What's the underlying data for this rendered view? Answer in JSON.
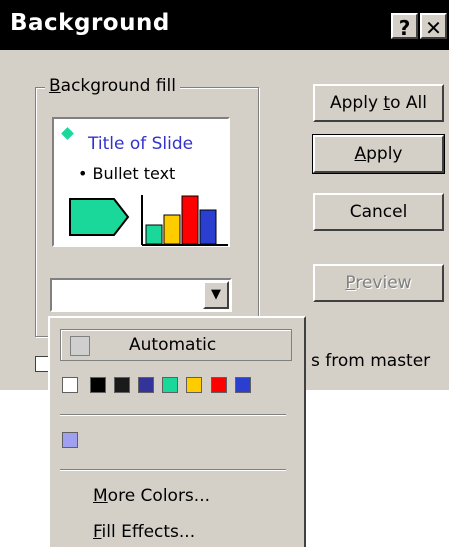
{
  "dialog": {
    "title": "Background",
    "help_label": "?",
    "close_label": "✕",
    "group_label": "Background fill",
    "group_label_access": "B",
    "group_label_rest": "ackground fill",
    "preview": {
      "title_text": "Title of Slide",
      "bullet_text": "• Bullet text"
    },
    "combo_arrow": "▼",
    "buttons": {
      "apply_all_pre": "Apply ",
      "apply_all_key": "t",
      "apply_all_post": "o All",
      "apply_key": "A",
      "apply_rest": "pply",
      "cancel": "Cancel",
      "preview_key": "P",
      "preview_rest": "review"
    },
    "omit_text": "s from master"
  },
  "popup": {
    "automatic": "Automatic",
    "swatches": [
      "#ffffff",
      "#000000",
      "#1a1a1a",
      "#333399",
      "#1ad89a",
      "#ffcc00",
      "#ff0000",
      "#2a3fcf"
    ],
    "recent_color": "#a0a0f0",
    "more_colors_key": "M",
    "more_colors_rest": "ore Colors...",
    "fill_effects_key": "F",
    "fill_effects_rest": "ill Effects..."
  },
  "colors": {
    "title_bar": "#000000",
    "face": "#d4d0c8",
    "preview_title": "#3333cc"
  }
}
